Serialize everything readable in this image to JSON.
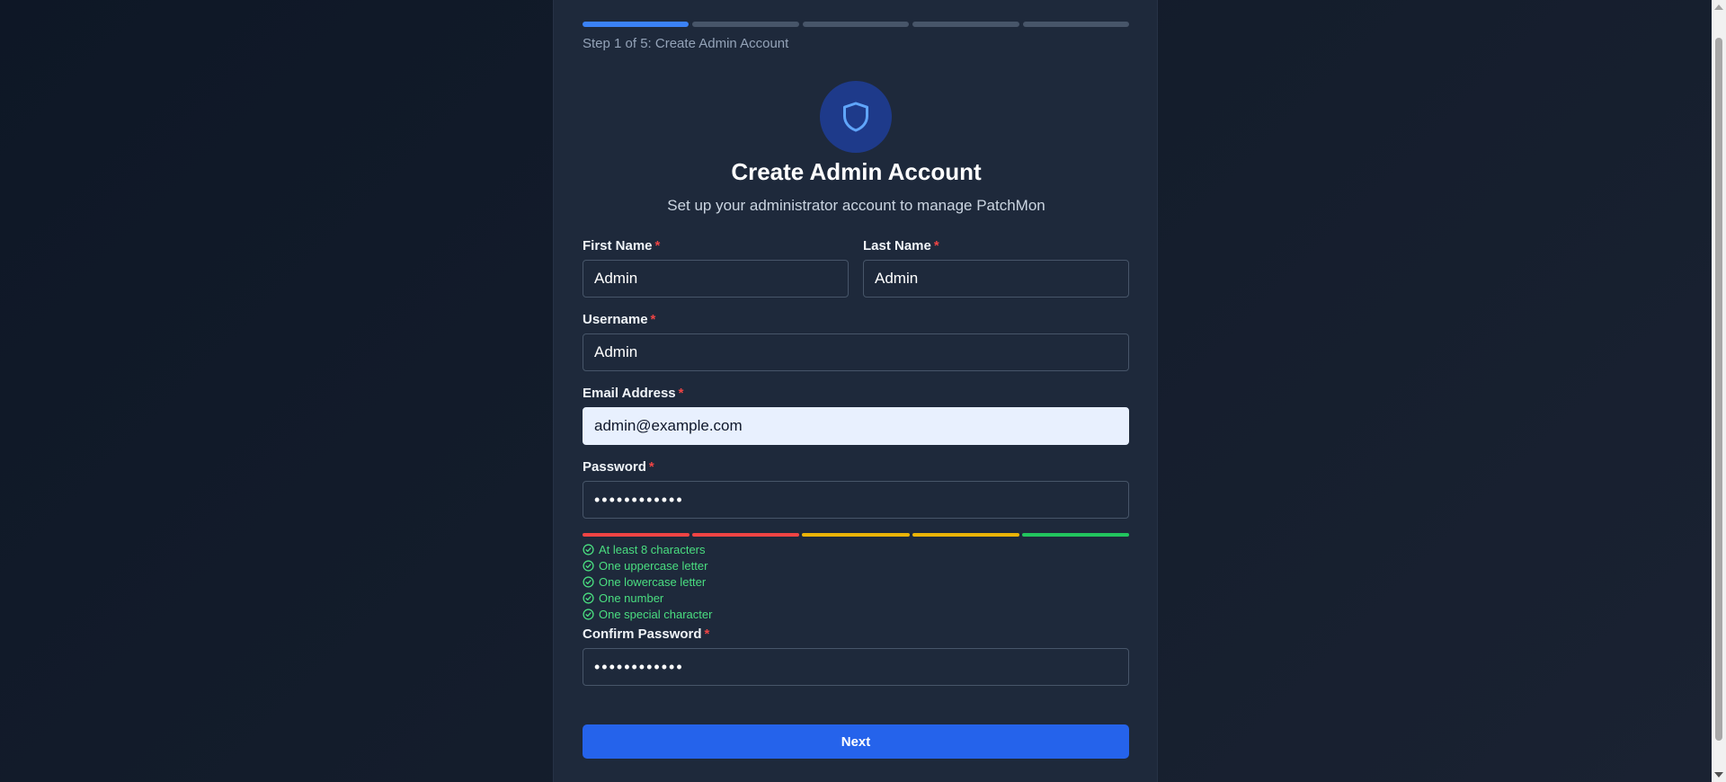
{
  "progress": {
    "current_step": 1,
    "total_steps": 5,
    "label": "Step 1 of 5: Create Admin Account",
    "colors": {
      "active": "#3b82f6",
      "inactive": "#475569"
    }
  },
  "header": {
    "icon": "shield-icon",
    "title": "Create Admin Account",
    "subtitle": "Set up your administrator account to manage PatchMon"
  },
  "form": {
    "required_marker": "*",
    "first_name": {
      "label": "First Name",
      "value": "Admin"
    },
    "last_name": {
      "label": "Last Name",
      "value": "Admin"
    },
    "username": {
      "label": "Username",
      "value": "Admin"
    },
    "email": {
      "label": "Email Address",
      "value": "admin@example.com"
    },
    "password": {
      "label": "Password",
      "value": "••••••••••••"
    },
    "confirm_password": {
      "label": "Confirm Password",
      "value": "••••••••••••"
    }
  },
  "password_strength": {
    "level": 5,
    "max": 5,
    "segment_colors": [
      "#ef4444",
      "#ef4444",
      "#eab308",
      "#eab308",
      "#22c55e"
    ],
    "requirements": [
      {
        "text": "At least 8 characters",
        "met": true
      },
      {
        "text": "One uppercase letter",
        "met": true
      },
      {
        "text": "One lowercase letter",
        "met": true
      },
      {
        "text": "One number",
        "met": true
      },
      {
        "text": "One special character",
        "met": true
      }
    ],
    "met_color": "#4ade80"
  },
  "actions": {
    "next_label": "Next",
    "accent": "#2563eb"
  }
}
